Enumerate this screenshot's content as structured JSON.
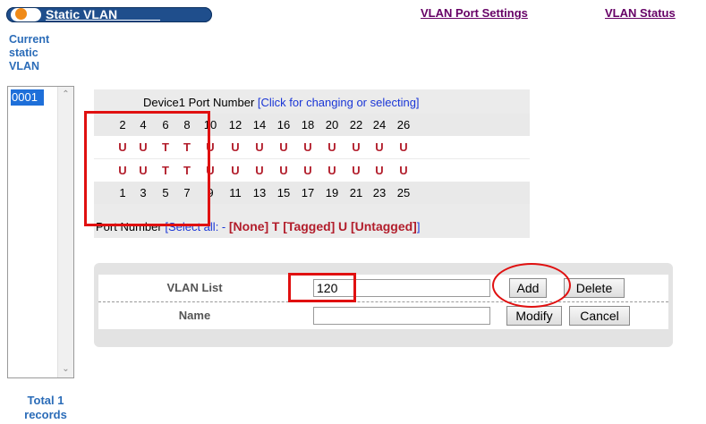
{
  "header": {
    "title": "Static VLAN",
    "links": [
      "VLAN Port Settings",
      "VLAN Status"
    ]
  },
  "sidebar": {
    "label_lines": [
      "Current",
      "static",
      "VLAN"
    ],
    "items": [
      "0001"
    ],
    "total": [
      "Total 1",
      "records"
    ]
  },
  "port_table": {
    "caption": "Device1 Port Number",
    "caption_link": "[Click for changing or selecting]",
    "top_numbers": [
      "2",
      "4",
      "6",
      "8",
      "10",
      "12",
      "14",
      "16",
      "18",
      "20",
      "22",
      "24",
      "26"
    ],
    "row1_modes": [
      "U",
      "U",
      "T",
      "T",
      "U",
      "U",
      "U",
      "U",
      "U",
      "U",
      "U",
      "U",
      "U"
    ],
    "row2_modes": [
      "U",
      "U",
      "T",
      "T",
      "U",
      "U",
      "U",
      "U",
      "U",
      "U",
      "U",
      "U",
      "U"
    ],
    "bottom_numbers": [
      "1",
      "3",
      "5",
      "7",
      "9",
      "11",
      "13",
      "15",
      "17",
      "19",
      "21",
      "23",
      "25"
    ],
    "footer_prefix": "Port Number",
    "footer_select": "[Select all: -",
    "footer_options": [
      "[None]",
      "T [Tagged]",
      "U [Untagged]"
    ],
    "footer_close": "]"
  },
  "form": {
    "vlan_list_label": "VLAN List",
    "vlan_list_value": "120",
    "name_label": "Name",
    "name_value": "",
    "add_label": "Add",
    "delete_label": "Delete",
    "modify_label": "Modify",
    "cancel_label": "Cancel"
  },
  "colors": {
    "header_bg": "#1f4e8c",
    "link": "#660066",
    "accent_blue": "#2b6cb8",
    "mode_red": "#b21d2b",
    "annotation_red": "#e01010"
  }
}
